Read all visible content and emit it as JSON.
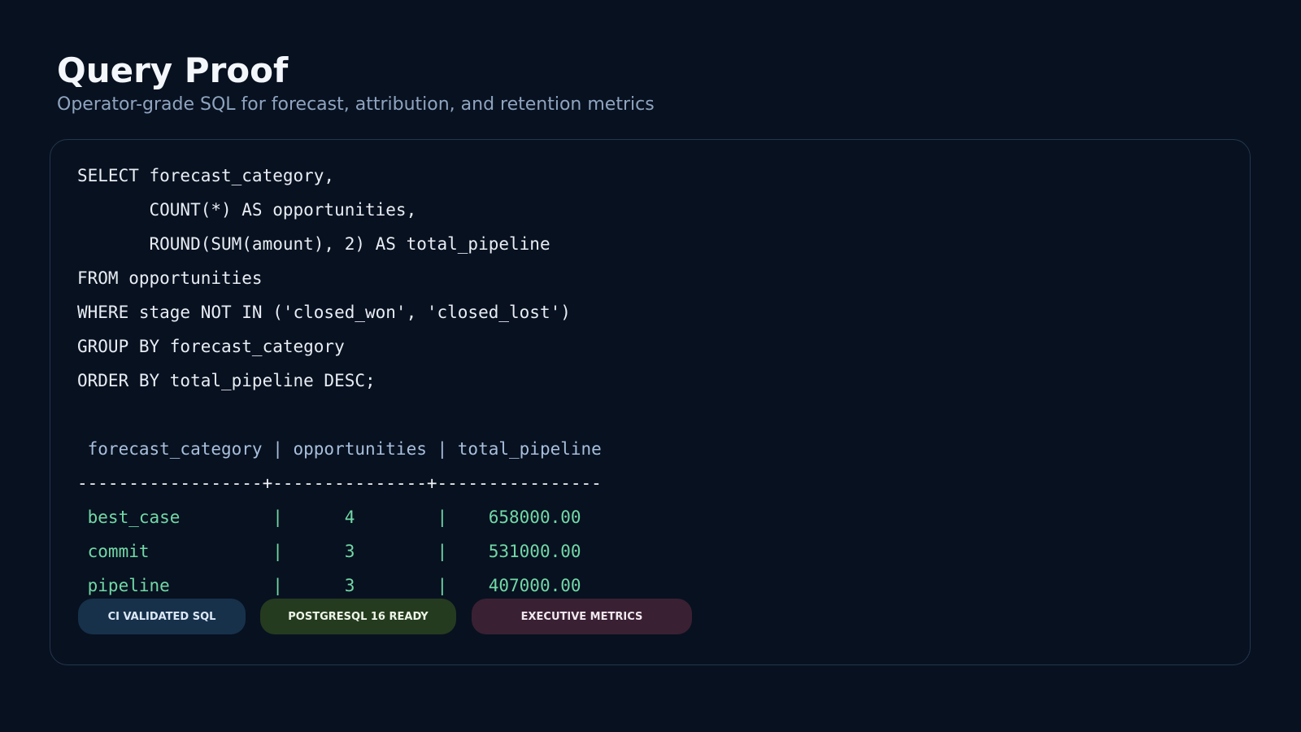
{
  "header": {
    "title": "Query Proof",
    "subtitle": "Operator-grade SQL for forecast, attribution, and retention metrics"
  },
  "code": {
    "lines": [
      "SELECT forecast_category,",
      "       COUNT(*) AS opportunities,",
      "       ROUND(SUM(amount), 2) AS total_pipeline",
      "FROM opportunities",
      "WHERE stage NOT IN ('closed_won', 'closed_lost')",
      "GROUP BY forecast_category",
      "ORDER BY total_pipeline DESC;"
    ]
  },
  "results": {
    "header": " forecast_category | opportunities | total_pipeline",
    "separator": "------------------+---------------+----------------",
    "rows": [
      " best_case         |      4        |    658000.00",
      " commit            |      3        |    531000.00",
      " pipeline          |      3        |    407000.00"
    ]
  },
  "badges": [
    {
      "label": "CI VALIDATED SQL",
      "background": "#17314b"
    },
    {
      "label": "POSTGRESQL 16 READY",
      "background": "#253b1f"
    },
    {
      "label": "EXECUTIVE METRICS",
      "background": "#3a2033"
    }
  ],
  "colors": {
    "background": "#081120",
    "title": "#f3f6fa",
    "subtitle": "#8fa4bf",
    "code": "#e8edf4",
    "result_header": "#a8bfdc",
    "result_rows": "#71d8a6",
    "panel_border": "#24364d"
  }
}
